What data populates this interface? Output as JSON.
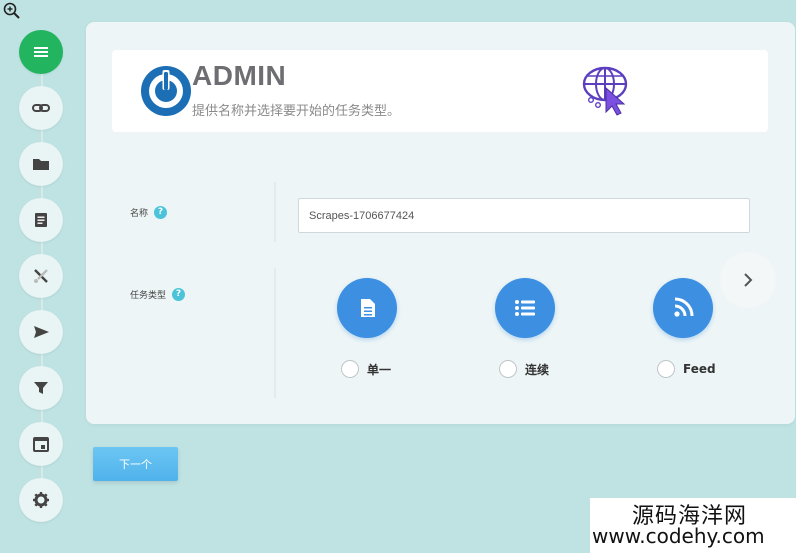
{
  "banner": {
    "logo_text": "ADMIN",
    "subtitle": "提供名称并选择要开始的任务类型。"
  },
  "form": {
    "name_label": "名称",
    "name_value": "Scrapes-1706677424",
    "type_label": "任务类型",
    "types": [
      {
        "label": "单一",
        "icon": "document-icon"
      },
      {
        "label": "连续",
        "icon": "list-icon"
      },
      {
        "label": "Feed",
        "icon": "rss-icon"
      }
    ]
  },
  "actions": {
    "next_label": "下一个"
  },
  "steps": [
    {
      "icon": "menu-icon",
      "active": true
    },
    {
      "icon": "link-icon"
    },
    {
      "icon": "folder-icon"
    },
    {
      "icon": "document-icon"
    },
    {
      "icon": "tools-icon"
    },
    {
      "icon": "send-icon"
    },
    {
      "icon": "filter-icon"
    },
    {
      "icon": "calendar-icon"
    },
    {
      "icon": "gear-icon"
    }
  ],
  "watermark": {
    "site_name": "源码海洋网",
    "url": "www.codehy.com"
  },
  "colors": {
    "background": "#bfe3e3",
    "active_step": "#22b45f",
    "type_circle": "#3d8fe2",
    "help_icon": "#4cc3d9",
    "next_button": "#5ab9ee"
  }
}
